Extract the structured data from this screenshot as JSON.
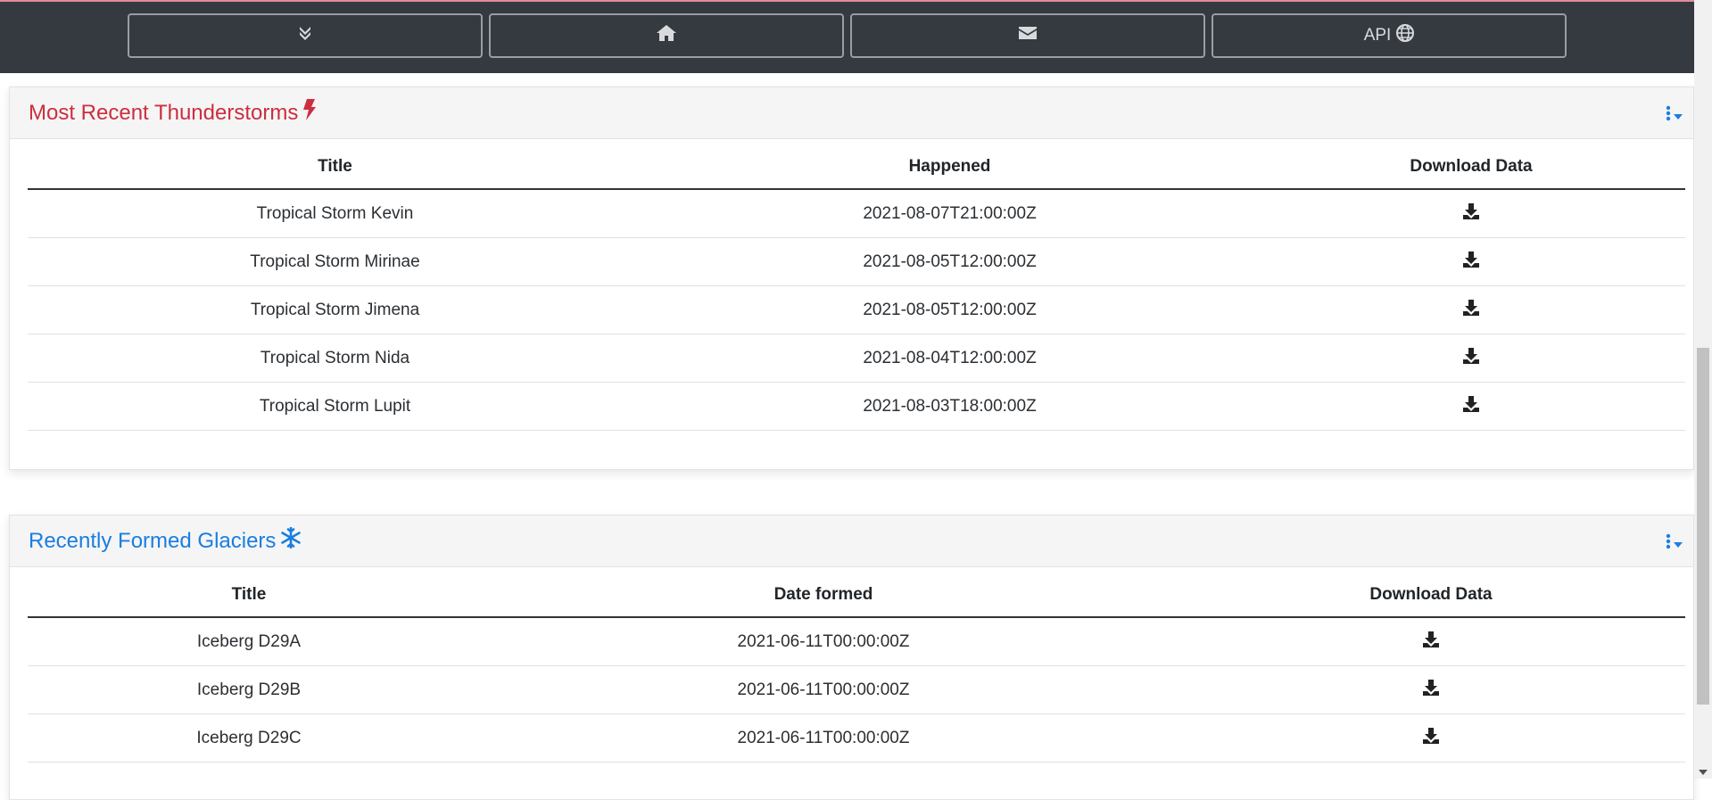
{
  "navbar": {
    "buttons": [
      {
        "icon": "double-chevron-down-icon",
        "label": ""
      },
      {
        "icon": "home-icon",
        "label": ""
      },
      {
        "icon": "envelope-icon",
        "label": ""
      },
      {
        "icon": "globe-icon",
        "label": "API"
      }
    ]
  },
  "thunderstorms": {
    "title": "Most Recent Thunderstorms",
    "title_icon": "lightning-bolt-icon",
    "title_color": "#cc2e3f",
    "columns": [
      "Title",
      "Happened",
      "Download Data"
    ],
    "rows": [
      {
        "title": "Tropical Storm Kevin",
        "date": "2021-08-07T21:00:00Z"
      },
      {
        "title": "Tropical Storm Mirinae",
        "date": "2021-08-05T12:00:00Z"
      },
      {
        "title": "Tropical Storm Jimena",
        "date": "2021-08-05T12:00:00Z"
      },
      {
        "title": "Tropical Storm Nida",
        "date": "2021-08-04T12:00:00Z"
      },
      {
        "title": "Tropical Storm Lupit",
        "date": "2021-08-03T18:00:00Z"
      }
    ]
  },
  "glaciers": {
    "title": "Recently Formed Glaciers",
    "title_icon": "snowflake-icon",
    "title_color": "#1a7ee0",
    "columns": [
      "Title",
      "Date formed",
      "Download Data"
    ],
    "rows": [
      {
        "title": "Iceberg D29A",
        "date": "2021-06-11T00:00:00Z"
      },
      {
        "title": "Iceberg D29B",
        "date": "2021-06-11T00:00:00Z"
      },
      {
        "title": "Iceberg D29C",
        "date": "2021-06-11T00:00:00Z"
      }
    ]
  },
  "colors": {
    "navbar_bg": "#343a40",
    "menu_accent": "#1a7ee0"
  }
}
